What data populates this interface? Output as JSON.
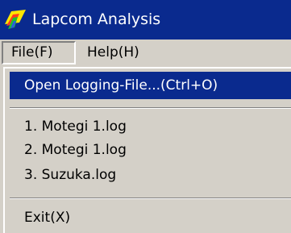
{
  "window": {
    "title": "Lapcom Analysis",
    "icon": "app-logo-icon"
  },
  "menubar": {
    "file_label": "File(F)",
    "help_label": "Help(H)"
  },
  "file_menu": {
    "open_label": "Open Logging-File...(Ctrl+O)",
    "recent_files": [
      "1.  Motegi 1.log",
      "2.  Motegi 1.log",
      "3.  Suzuka.log"
    ],
    "exit_label": "Exit(X)"
  },
  "colors": {
    "highlight": "#0a2a8e",
    "face": "#d4d0c8"
  }
}
